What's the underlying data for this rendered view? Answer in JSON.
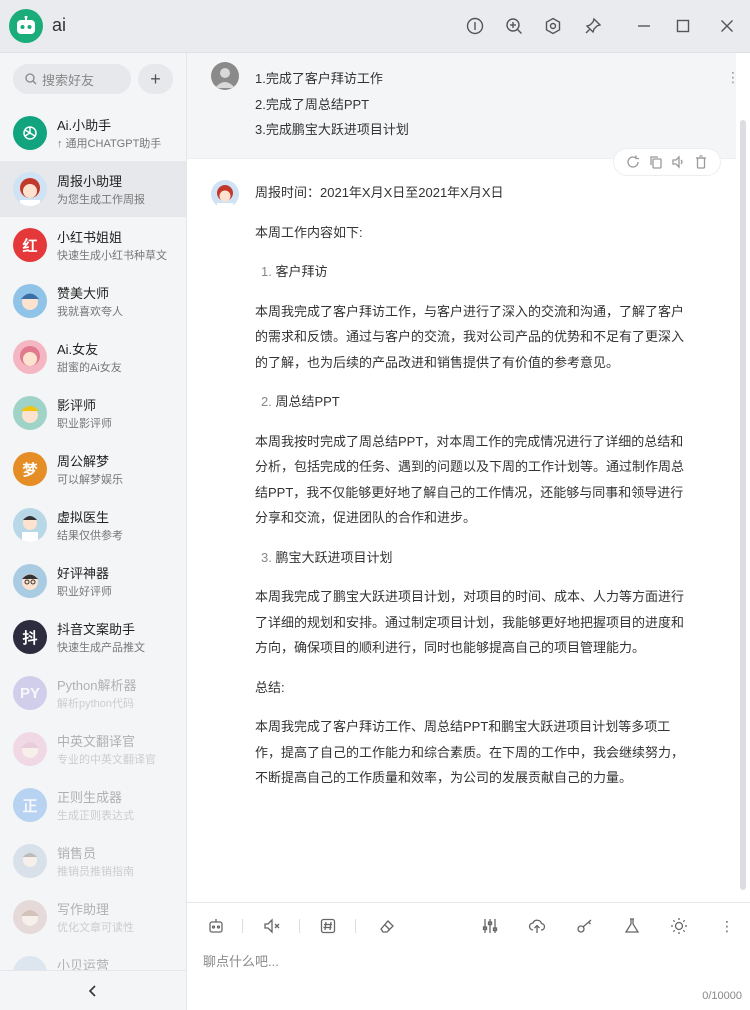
{
  "app": {
    "title": "ai"
  },
  "sidebar": {
    "search_placeholder": "搜索好友",
    "add_label": "+",
    "contacts": [
      {
        "name": "Ai.小助手",
        "desc": "↑ 通用CHATGPT助手",
        "avatar_text": "",
        "color": "#12a37f"
      },
      {
        "name": "周报小助理",
        "desc": "为您生成工作周报",
        "avatar_text": "",
        "color": "#cfe3f5"
      },
      {
        "name": "小红书姐姐",
        "desc": "快速生成小红书种草文",
        "avatar_text": "红",
        "color": "#e5383b"
      },
      {
        "name": "赞美大师",
        "desc": "我就喜欢夸人",
        "avatar_text": "",
        "color": "#8fc3e8"
      },
      {
        "name": "Ai.女友",
        "desc": "甜蜜的Ai女友",
        "avatar_text": "",
        "color": "#f4b6c2"
      },
      {
        "name": "影评师",
        "desc": "职业影评师",
        "avatar_text": "",
        "color": "#9fd3c7"
      },
      {
        "name": "周公解梦",
        "desc": "可以解梦娱乐",
        "avatar_text": "梦",
        "color": "#e58e26"
      },
      {
        "name": "虚拟医生",
        "desc": "结果仅供参考",
        "avatar_text": "",
        "color": "#b8d8e8"
      },
      {
        "name": "好评神器",
        "desc": "职业好评师",
        "avatar_text": "",
        "color": "#a9cce3"
      },
      {
        "name": "抖音文案助手",
        "desc": "快速生成产品推文",
        "avatar_text": "抖",
        "color": "#2c2c3e"
      },
      {
        "name": "Python解析器",
        "desc": "解析python代码",
        "avatar_text": "PY",
        "color": "#8b7fd6"
      },
      {
        "name": "中英文翻译官",
        "desc": "专业的中英文翻译官",
        "avatar_text": "",
        "color": "#e8a0c0"
      },
      {
        "name": "正则生成器",
        "desc": "生成正则表达式",
        "avatar_text": "正",
        "color": "#3a8ee6"
      },
      {
        "name": "销售员",
        "desc": "推销员推销指南",
        "avatar_text": "",
        "color": "#a0b8d0"
      },
      {
        "name": "写作助理",
        "desc": "优化文章可读性",
        "avatar_text": "",
        "color": "#c9a0a0"
      },
      {
        "name": "小贝运营",
        "desc": "",
        "avatar_text": "",
        "color": "#b0c4de"
      }
    ],
    "collapse_icon": "chevron-left-icon"
  },
  "chat": {
    "user_message": [
      "1.完成了客户拜访工作",
      "2.完成了周总结PPT",
      "3.完成鹏宝大跃进项目计划"
    ],
    "bot_response": {
      "line1": "周报时间：2021年X月X日至2021年X月X日",
      "line2": "本周工作内容如下:",
      "h1": "客户拜访",
      "h1_num": "1.",
      "p1": "本周我完成了客户拜访工作，与客户进行了深入的交流和沟通，了解了客户的需求和反馈。通过与客户的交流，我对公司产品的优势和不足有了更深入的了解，也为后续的产品改进和销售提供了有价值的参考意见。",
      "h2": "周总结PPT",
      "h2_num": "2.",
      "p2": "本周我按时完成了周总结PPT，对本周工作的完成情况进行了详细的总结和分析，包括完成的任务、遇到的问题以及下周的工作计划等。通过制作周总结PPT，我不仅能够更好地了解自己的工作情况，还能够与同事和领导进行分享和交流，促进团队的合作和进步。",
      "h3": "鹏宝大跃进项目计划",
      "h3_num": "3.",
      "p3": "本周我完成了鹏宝大跃进项目计划，对项目的时间、成本、人力等方面进行了详细的规划和安排。通过制定项目计划，我能够更好地把握项目的进度和方向，确保项目的顺利进行，同时也能够提高自己的项目管理能力。",
      "summary_label": "总结:",
      "p4": "本周我完成了客户拜访工作、周总结PPT和鹏宝大跃进项目计划等多项工作，提高了自己的工作能力和综合素质。在下周的工作中，我会继续努力，不断提高自己的工作质量和效率，为公司的发展贡献自己的力量。"
    }
  },
  "input": {
    "placeholder": "聊点什么吧...",
    "counter": "0/10000"
  },
  "colors": {
    "brand": "#1aad7a",
    "sidebar_bg": "#f4f5f7",
    "active_bg": "#e6e8eb"
  }
}
